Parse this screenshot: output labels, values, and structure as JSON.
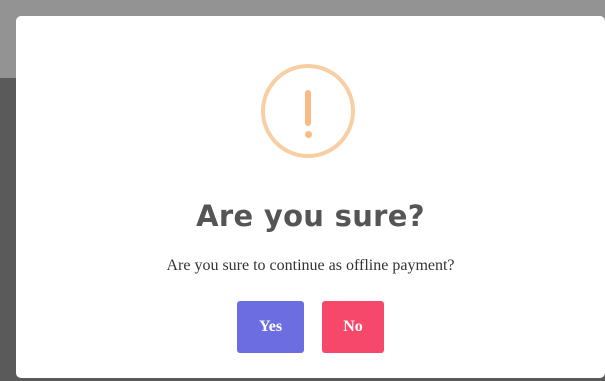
{
  "dialog": {
    "icon": "exclamation-warning-icon",
    "title": "Are you sure?",
    "message": "Are you sure to continue as offline payment?",
    "confirm_label": "Yes",
    "cancel_label": "No"
  },
  "colors": {
    "icon_ring": "#f8cea3",
    "icon_mark": "#f8bb86",
    "confirm_button": "#6b6de0",
    "cancel_button": "#f5486a",
    "title_text": "#555555",
    "backdrop": "#5a5a5a"
  }
}
